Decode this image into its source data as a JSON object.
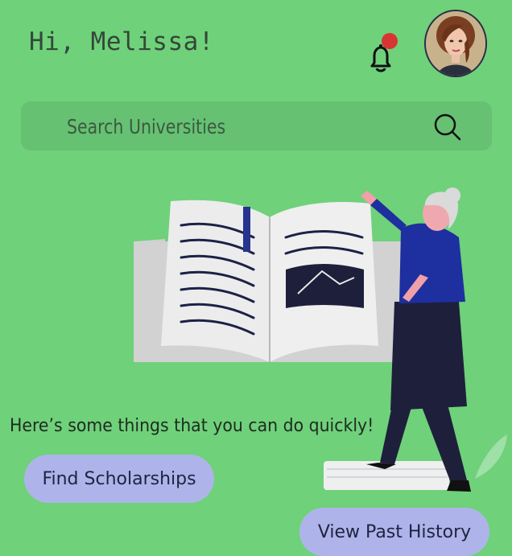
{
  "header": {
    "greeting": "Hi, Melissa!",
    "notification_icon": "bell-icon",
    "notification_badge_color": "#d83434",
    "avatar_icon": "profile-photo"
  },
  "search": {
    "placeholder": "Search Universities",
    "icon": "search-icon"
  },
  "illustration": {
    "icon": "open-book-reader-illustration"
  },
  "quick_actions": {
    "heading": "Here’s some things that you can do quickly!",
    "find_scholarships_label": "Find Scholarships",
    "view_past_history_label": "View Past History"
  },
  "colors": {
    "background": "#6fd17a",
    "search_bar": "#66c172",
    "action_pill": "#aeb4ea"
  }
}
